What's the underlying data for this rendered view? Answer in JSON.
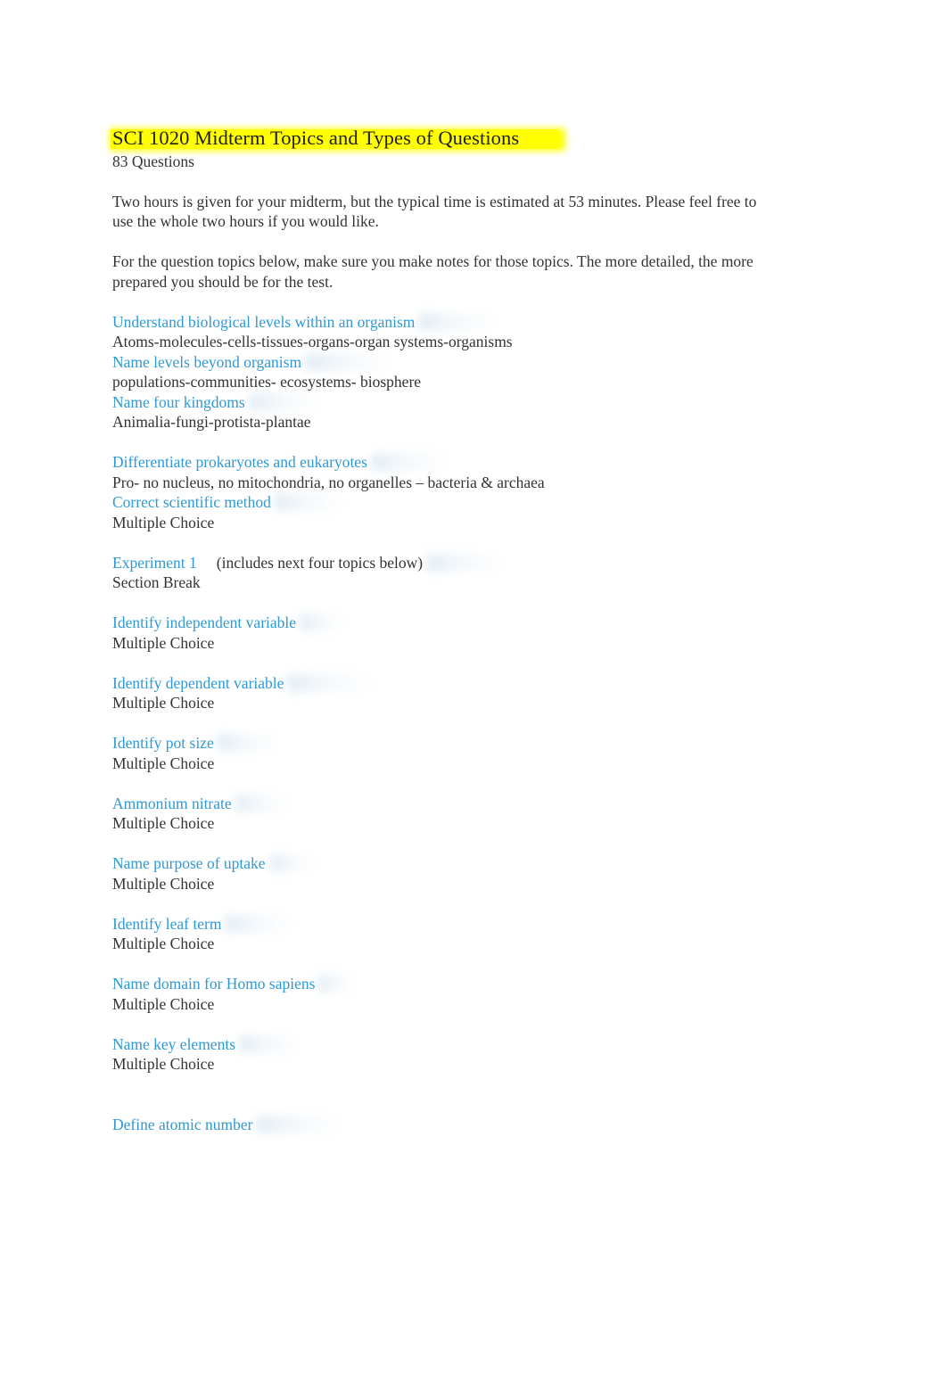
{
  "document": {
    "title": "SCI 1020 Midterm Topics and Types of Questions",
    "subtitle": "83 Questions",
    "highlight_color": "#ffff00",
    "heading_color": "#2f99d6",
    "body_color": "#333333",
    "paragraphs": [
      "Two hours is given for your midterm, but the typical time is estimated at 53 minutes. Please feel free to use the whole two hours if you would like.",
      "For the question topics below, make sure you make notes for those topics. The more detailed, the more prepared you should be for the test."
    ],
    "topics": [
      {
        "heading": "Understand biological levels within an organism",
        "answer": "Atoms-molecules-cells-tissues-organs-organ systems-organisms",
        "note": "",
        "gap_before": false
      },
      {
        "heading": "Name levels beyond organism",
        "answer": "populations-communities- ecosystems- biosphere",
        "note": "",
        "gap_before": false
      },
      {
        "heading": "Name four kingdoms",
        "answer": "Animalia-fungi-protista-plantae",
        "note": "",
        "gap_before": false
      },
      {
        "heading": "Differentiate prokaryotes and eukaryotes",
        "answer": "Pro- no nucleus, no mitochondria, no organelles – bacteria & archaea",
        "note": "",
        "gap_before": true
      },
      {
        "heading": "Correct scientific method",
        "answer": "Multiple Choice",
        "note": "",
        "gap_before": false
      },
      {
        "heading": "Experiment 1",
        "answer": "Section Break",
        "note": "(includes next four topics below)",
        "gap_before": true
      },
      {
        "heading": "Identify independent variable",
        "answer": "Multiple Choice",
        "note": "",
        "gap_before": true
      },
      {
        "heading": "Identify dependent variable",
        "answer": "Multiple Choice",
        "note": "",
        "gap_before": true
      },
      {
        "heading": "Identify pot size",
        "answer": "Multiple Choice",
        "note": "",
        "gap_before": true
      },
      {
        "heading": "Ammonium nitrate",
        "answer": "Multiple Choice",
        "note": "",
        "gap_before": true
      },
      {
        "heading": "Name purpose of uptake",
        "answer": "Multiple Choice",
        "note": "",
        "gap_before": true
      },
      {
        "heading": "Identify leaf term",
        "answer": "Multiple Choice",
        "note": "",
        "gap_before": true
      },
      {
        "heading": "Name domain for Homo sapiens",
        "answer": "Multiple Choice",
        "note": "",
        "gap_before": true
      },
      {
        "heading": "Name key elements",
        "answer": "Multiple Choice",
        "note": "",
        "gap_before": true
      },
      {
        "heading": "Define atomic number",
        "answer": "",
        "note": "",
        "gap_before": true,
        "extra_gap": true
      }
    ]
  }
}
